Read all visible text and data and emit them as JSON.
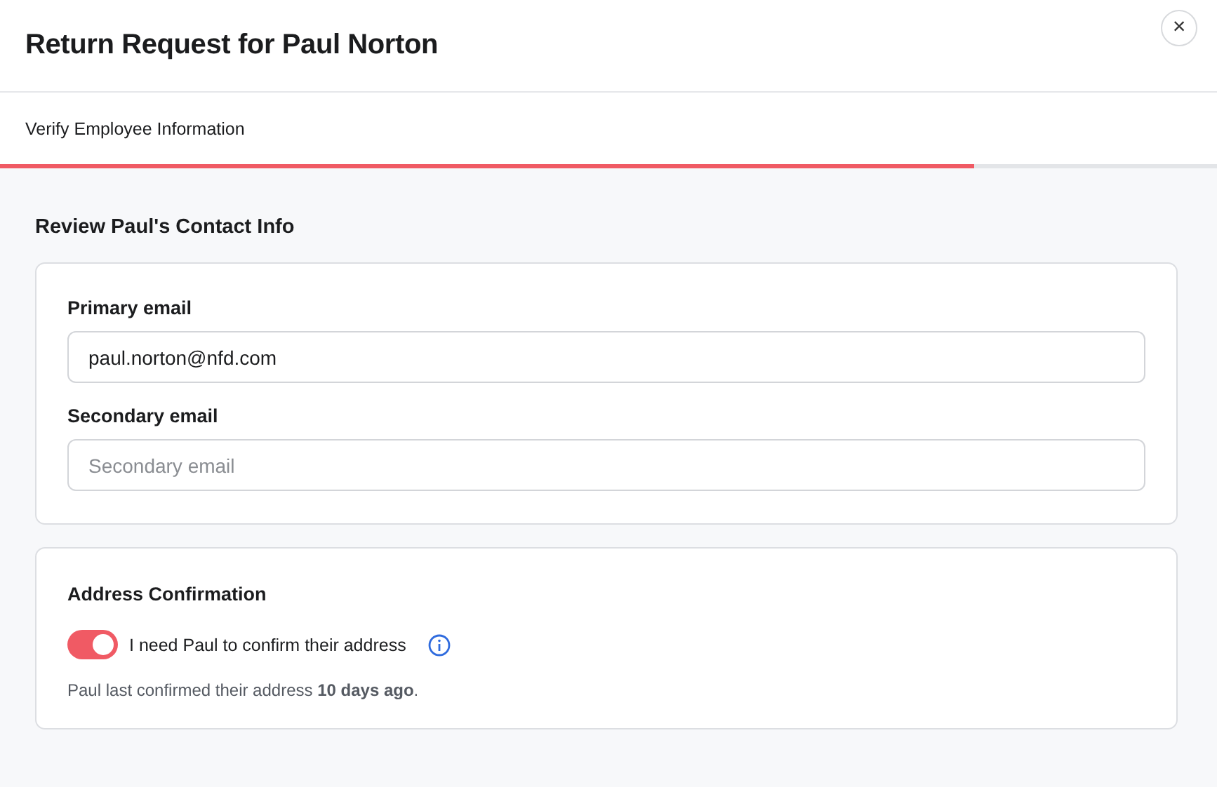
{
  "dialog": {
    "title": "Return Request for Paul Norton",
    "close": "×"
  },
  "step": {
    "label": "Verify Employee Information",
    "level": 0.8
  },
  "contact": {
    "heading": "Review Paul's Contact Info",
    "fields": [
      {
        "label": "Primary email",
        "value": "paul.norton@nfd.com"
      },
      {
        "label": "Secondary email",
        "placeholder": "Secondary email"
      }
    ]
  },
  "address": {
    "heading": "Address Confirmation",
    "toggle": {
      "label": "I need Paul to confirm their address",
      "on": true
    },
    "note": "Paul last confirmed their address **10 days ago**."
  }
}
